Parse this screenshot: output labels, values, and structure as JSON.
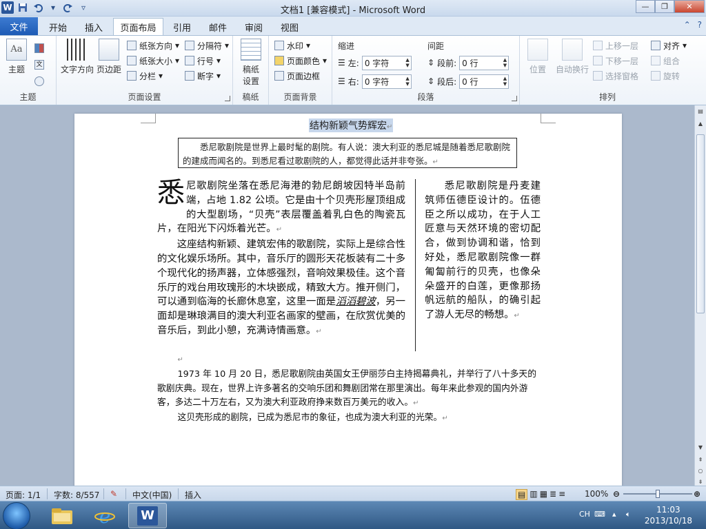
{
  "window": {
    "title": "文档1 [兼容模式] - Microsoft Word",
    "logo": "W"
  },
  "qat": {
    "icons": [
      "save-icon",
      "undo-icon",
      "redo-icon",
      "customize-icon"
    ]
  },
  "tabs": {
    "file": "文件",
    "items": [
      "开始",
      "插入",
      "页面布局",
      "引用",
      "邮件",
      "审阅",
      "视图"
    ],
    "active": "页面布局"
  },
  "ribbon": {
    "theme_group": {
      "label": "主题",
      "theme": "主题",
      "colors_icon": "colors-icon",
      "fonts_icon": "fonts-icon",
      "effects_icon": "effects-icon"
    },
    "page_setup": {
      "label": "页面设置",
      "text_direction": "文字方向",
      "margins": "页边距",
      "orientation": "纸张方向",
      "size": "纸张大小",
      "columns": "分栏",
      "breaks": "分隔符",
      "line_numbers": "行号",
      "hyphenation": "断字"
    },
    "manuscript": {
      "label": "稿纸",
      "settings_line1": "稿纸",
      "settings_line2": "设置"
    },
    "page_bg": {
      "label": "页面背景",
      "watermark": "水印",
      "page_color": "页面颜色",
      "page_borders": "页面边框"
    },
    "paragraph": {
      "label": "段落",
      "indent_title": "缩进",
      "spacing_title": "间距",
      "left_label": "左:",
      "left_value": "0 字符",
      "right_label": "右:",
      "right_value": "0 字符",
      "before_label": "段前:",
      "before_value": "0 行",
      "after_label": "段后:",
      "after_value": "0 行"
    },
    "arrange": {
      "label": "排列",
      "position": "位置",
      "wrap": "自动换行",
      "bring_forward": "上移一层",
      "send_backward": "下移一层",
      "selection_pane": "选择窗格",
      "align": "对齐",
      "group": "组合",
      "rotate": "旋转"
    }
  },
  "document": {
    "headline": "结构新颖气势辉宏",
    "abstract": "悉尼歌剧院是世界上最时髦的剧院。有人说：澳大利亚的悉尼城是随着悉尼歌剧院的建成而闻名的。到悉尼看过歌剧院的人，都觉得此话并非夸张。",
    "dropcap": "悉",
    "col1_p1": "尼歌剧院坐落在悉尼海港的勃尼朗坡因特半岛前端，占地 1.82 公顷。它是由十个贝壳形屋顶组成的大型剧场，“贝壳”表层覆盖着乳白色的陶瓷瓦片，在阳光下闪烁着光芒。",
    "col1_p2_a": "这座结构新颖、建筑宏伟的歌剧院，实际上是综合性的文化娱乐场所。其中，音乐厅的圆形天花板装有二十多个现代化的扬声器，立体感强烈，音响效果极佳。这个音乐厅的戏台用玫瑰形的木块嵌成，精致大方。推开侧门，可以通到临海的长廊休息室，这里一面是",
    "col1_p2_ital": "滔滔碧波",
    "col1_p2_b": "，另一面却是琳琅满目的澳大利亚名画家的壁画，在欣赏优美的音乐后，到此小憩，充满诗情画意。",
    "col2": "悉尼歌剧院是丹麦建筑师伍德臣设计的。伍德臣之所以成功，在于人工匠意与天然环境的密切配合，做到协调和谐，恰到好处，悉尼歌剧院像一群匍匐前行的贝壳，也像朵朵盛开的白莲，更像那扬帆远航的船队，的确引起了游人无尽的畅想。",
    "p3": "1973 年 10 月 20 日，悉尼歌剧院由英国女王伊丽莎白主持揭幕典礼，并举行了八十多天的歌剧庆典。现在，世界上许多著名的交响乐团和舞剧团常在那里演出。每年来此参观的国内外游客，多达二十万左右，又为澳大利亚政府挣来数百万美元的收入。",
    "p4": "这贝壳形成的剧院，已成为悉尼市的象征，也成为澳大利亚的光荣。",
    "para_mark": "↵"
  },
  "status": {
    "page": "页面: 1/1",
    "words": "字数: 8/557",
    "language": "中文(中国)",
    "insert": "插入",
    "zoom": "100%",
    "zoom_fraction": 0.5
  },
  "taskbar": {
    "apps": [
      "explorer-icon",
      "ie-icon",
      "word-icon"
    ],
    "ime": "CH",
    "time": "11:03",
    "date": "2013/10/18"
  },
  "colors": {
    "accent": "#2b579a",
    "file_tab": "#1e5bb5",
    "selection": "#c7d7ec"
  }
}
